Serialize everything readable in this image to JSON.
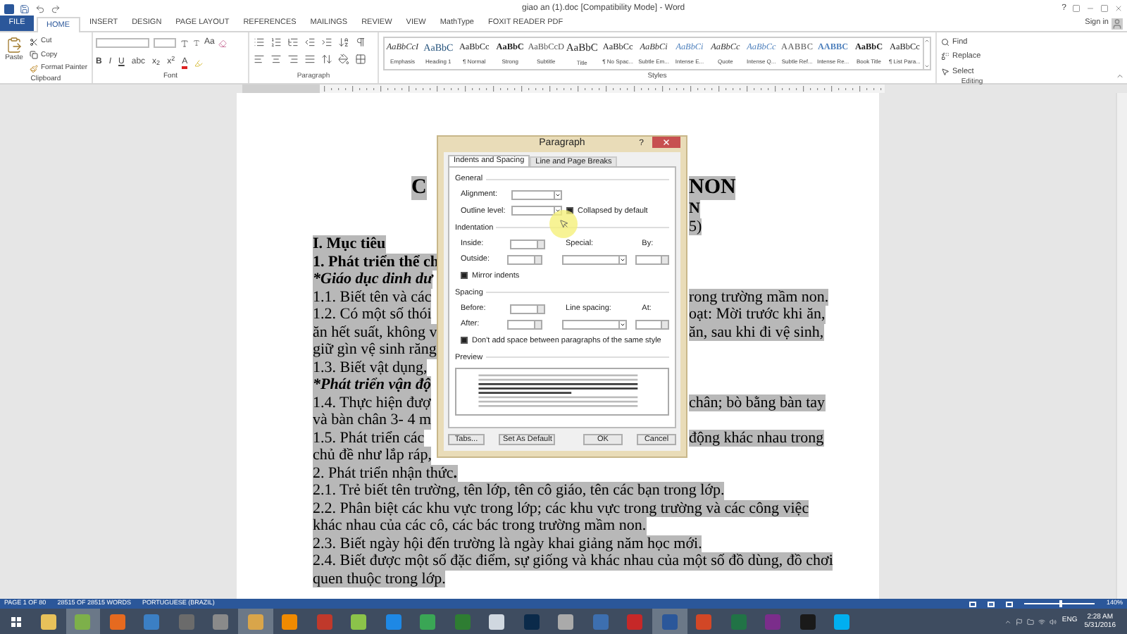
{
  "title_bar": {
    "title": "giao an (1).doc [Compatibility Mode] - Word",
    "help": "?",
    "sign_in": "Sign in"
  },
  "ribbon_tabs": [
    {
      "label": "FILE",
      "kind": "file",
      "selected": false
    },
    {
      "label": "HOME",
      "kind": "tab",
      "selected": true
    },
    {
      "label": "INSERT",
      "kind": "tab",
      "selected": false
    },
    {
      "label": "DESIGN",
      "kind": "tab",
      "selected": false
    },
    {
      "label": "PAGE LAYOUT",
      "kind": "tab",
      "selected": false
    },
    {
      "label": "REFERENCES",
      "kind": "tab",
      "selected": false
    },
    {
      "label": "MAILINGS",
      "kind": "tab",
      "selected": false
    },
    {
      "label": "REVIEW",
      "kind": "tab",
      "selected": false
    },
    {
      "label": "VIEW",
      "kind": "tab",
      "selected": false
    },
    {
      "label": "MathType",
      "kind": "tab",
      "selected": false
    },
    {
      "label": "FOXIT READER PDF",
      "kind": "tab",
      "selected": false
    }
  ],
  "clipboard": {
    "paste": "Paste",
    "items": [
      "Cut",
      "Copy",
      "Format Painter"
    ],
    "label": "Clipboard"
  },
  "font": {
    "case_button": "Aa",
    "label": "Font",
    "buttons": [
      {
        "label": "B",
        "kind": "bold"
      },
      {
        "label": "I",
        "kind": "italic"
      },
      {
        "label": "U",
        "kind": "underline"
      },
      {
        "label": "abc",
        "kind": "strike"
      },
      {
        "label": "x$_{2}$",
        "kind": "plain"
      },
      {
        "label": "x$^{2}$",
        "kind": "plain"
      },
      {
        "label": "A",
        "kind": "fontcolor"
      }
    ]
  },
  "paragraph_group": {
    "label": "Paragraph"
  },
  "styles": {
    "label": "Styles",
    "items": [
      {
        "preview": "AaBbCcI",
        "name": "Emphasis",
        "kind": "italic"
      },
      {
        "preview": "AaBbC",
        "name": "Heading 1",
        "kind": "heading"
      },
      {
        "preview": "AaBbCc",
        "name": "¶ Normal",
        "kind": "normal"
      },
      {
        "preview": "AaBbC",
        "name": "Strong",
        "kind": "strong"
      },
      {
        "preview": "AaBbCcD",
        "name": "Subtitle",
        "kind": "subtle"
      },
      {
        "preview": "AaBbC",
        "name": "Title",
        "kind": "title"
      },
      {
        "preview": "AaBbCc",
        "name": "¶ No Spac...",
        "kind": "normal"
      },
      {
        "preview": "AaBbCi",
        "name": "Subtle Em...",
        "kind": "italic"
      },
      {
        "preview": "AaBbCi",
        "name": "Intense E...",
        "kind": "accent"
      },
      {
        "preview": "AaBbCc",
        "name": "Quote",
        "kind": "italic"
      },
      {
        "preview": "AaBbCc",
        "name": "Intense Q...",
        "kind": "accent"
      },
      {
        "preview": "AABBC",
        "name": "Subtle Ref...",
        "kind": "caps"
      },
      {
        "preview": "AABBC",
        "name": "Intense Re...",
        "kind": "accentcaps"
      },
      {
        "preview": "AaBbC",
        "name": "Book Title",
        "kind": "strong"
      },
      {
        "preview": "AaBbCc",
        "name": "¶ List Para...",
        "kind": "normal"
      }
    ]
  },
  "editing": {
    "label": "Editing",
    "items": [
      {
        "label": "Find",
        "kind": "find"
      },
      {
        "label": "Replace",
        "kind": "replace"
      },
      {
        "label": "Select",
        "kind": "select"
      }
    ]
  },
  "document": {
    "lines": [
      {
        "kind": "title",
        "left": "C",
        "right": "NON"
      },
      {
        "kind": "subtitle",
        "right": "N"
      },
      {
        "kind": "plain",
        "right": "5)"
      },
      {
        "kind": "bold",
        "left": "I. Mục tiêu"
      },
      {
        "kind": "bold",
        "left": "1. Phát triển thể ch"
      },
      {
        "kind": "bolditalic",
        "left": "*Giáo dục dinh dư"
      },
      {
        "kind": "plain",
        "left": "1.1. Biết tên và các",
        "right": "rong trường mầm non."
      },
      {
        "kind": "plain",
        "left": "1.2. Có một số thói",
        "right": "oạt: Mời trước khi ăn,"
      },
      {
        "kind": "plain",
        "left": "ăn hết suất, không v",
        "right": "ăn, sau khi đi vệ sinh,"
      },
      {
        "kind": "plain",
        "left": "giữ gìn vệ sinh răng"
      },
      {
        "kind": "plain",
        "left": "1.3. Biết vật dụng,"
      },
      {
        "kind": "bolditalic",
        "left": "*Phát triển vận độ"
      },
      {
        "kind": "plain",
        "left": "1.4. Thực hiện đượ",
        "right": "chân; bò bằng bàn tay"
      },
      {
        "kind": "plain",
        "left": "và bàn chân 3- 4 m"
      },
      {
        "kind": "plain",
        "left": "1.5. Phát triển các",
        "right": "động khác nhau trong"
      },
      {
        "kind": "plain",
        "left": "chủ đề như lắp ráp,"
      },
      {
        "kind": "boldend",
        "left": "2. Phát triển nhận thức**.**"
      },
      {
        "kind": "plain",
        "left": "2.1. Trẻ biết tên trường, tên lớp, tên cô giáo, tên các bạn trong lớp."
      },
      {
        "kind": "plain",
        "left": "2.2. Phân biệt các khu vực trong lớp; các khu vực trong trường và các công việc"
      },
      {
        "kind": "plain",
        "left": "khác nhau của các cô, các bác trong trường mầm non."
      },
      {
        "kind": "plain",
        "left": "2.3. Biết ngày hội đến trường là ngày khai giảng năm học mới."
      },
      {
        "kind": "plain",
        "left": "2.4. Biết được một số đặc điểm, sự giống và khác nhau của một số đồ dùng, đồ chơi"
      },
      {
        "kind": "plain",
        "left": "quen thuộc trong lớp."
      }
    ]
  },
  "dialog": {
    "title": "Paragraph",
    "help": "?",
    "tabs": [
      {
        "label": "Indents and Spacing",
        "selected": true
      },
      {
        "label": "Line and Page Breaks",
        "selected": false
      }
    ],
    "general": {
      "heading": "General",
      "alignment": "Alignment:",
      "outline": "Outline level:",
      "collapsed": {
        "label": "Collapsed by default",
        "checked": true
      }
    },
    "indentation": {
      "heading": "Indentation",
      "inside": "Inside:",
      "outside": "Outside:",
      "special": "Special:",
      "by": "By:",
      "mirror": {
        "label": "Mirror indents",
        "checked": true
      }
    },
    "spacing": {
      "heading": "Spacing",
      "before": "Before:",
      "after": "After:",
      "line_spacing": "Line spacing:",
      "at": "At:",
      "dont_add": {
        "label": "Don't add space between paragraphs of the same style",
        "checked": true
      }
    },
    "preview": {
      "heading": "Preview"
    },
    "buttons": [
      "Tabs...",
      "Set As Default",
      "OK",
      "Cancel"
    ]
  },
  "status_bar": {
    "page": "PAGE 1 OF 80",
    "words": "28515 OF 28515 WORDS",
    "language": "PORTUGUESE (BRAZIL)",
    "zoom": "140%",
    "level": 0.5
  },
  "taskbar": {
    "apps": [
      {
        "color": "#e8c15a",
        "selected": false
      },
      {
        "color": "#7db04a",
        "selected": true
      },
      {
        "color": "#e66a1f",
        "selected": false
      },
      {
        "color": "#3b7fc4",
        "selected": false
      },
      {
        "color": "#6b6b6b",
        "selected": false
      },
      {
        "color": "#8a8a8a",
        "selected": false
      },
      {
        "color": "#d9a54a",
        "selected": true
      },
      {
        "color": "#f08a00",
        "selected": false
      },
      {
        "color": "#c0392b",
        "selected": false
      },
      {
        "color": "#8bc34a",
        "selected": false
      },
      {
        "color": "#1e88e5",
        "selected": false
      },
      {
        "color": "#3aa655",
        "selected": false
      },
      {
        "color": "#2e7d32",
        "selected": false
      },
      {
        "color": "#d0d8e0",
        "selected": false
      },
      {
        "color": "#0b2a4a",
        "selected": false
      },
      {
        "color": "#aaaaaa",
        "selected": false
      },
      {
        "color": "#3d6fb0",
        "selected": false
      },
      {
        "color": "#c62828",
        "selected": false
      },
      {
        "color": "#2b579a",
        "selected": true
      },
      {
        "color": "#d24726",
        "selected": false
      },
      {
        "color": "#217346",
        "selected": false
      },
      {
        "color": "#7b2d8b",
        "selected": false
      },
      {
        "color": "#1a1a1a",
        "selected": false
      },
      {
        "color": "#00aff0",
        "selected": false
      }
    ],
    "language": "ENG",
    "time": "2:28 AM",
    "date": "5/31/2016"
  }
}
